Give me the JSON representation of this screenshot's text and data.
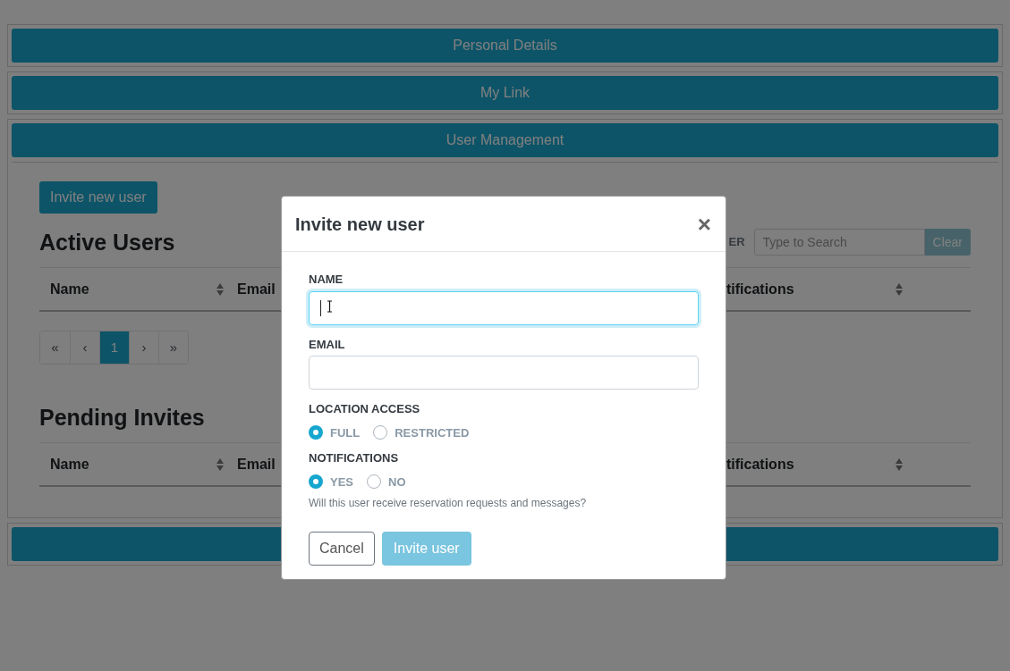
{
  "accordion": [
    {
      "title": "Personal Details",
      "expanded": false
    },
    {
      "title": "My Link",
      "expanded": false
    },
    {
      "title": "User Management",
      "expanded": true
    },
    {
      "expanded": false
    }
  ],
  "user_management": {
    "invite_button": "Invite new user",
    "active_users": {
      "heading": "Active Users",
      "filter_label": "ER",
      "search": {
        "placeholder": "Type to Search"
      },
      "clear_button": "Clear",
      "columns": [
        "Name",
        "Email",
        "tifications"
      ]
    },
    "pagination": [
      {
        "label": "«",
        "selected": false
      },
      {
        "label": "‹",
        "selected": false
      },
      {
        "label": "1",
        "selected": true
      },
      {
        "label": "›",
        "selected": false
      },
      {
        "label": "»",
        "selected": false
      }
    ],
    "pending_invites": {
      "heading": "Pending Invites",
      "columns": [
        "Name",
        "Email",
        "tifications"
      ]
    }
  },
  "modal": {
    "title": "Invite new user",
    "close": "×",
    "fields": [
      {
        "label": "NAME",
        "focused": true
      },
      {
        "label": "EMAIL",
        "focused": false
      }
    ],
    "radio_groups": [
      {
        "label": "LOCATION ACCESS",
        "options": [
          {
            "label": "FULL",
            "selected": true
          },
          {
            "label": "RESTRICTED",
            "selected": false
          }
        ]
      },
      {
        "label": "NOTIFICATIONS",
        "options": [
          {
            "label": "YES",
            "selected": true
          },
          {
            "label": "NO",
            "selected": false
          }
        ],
        "help": "Will this user receive reservation requests and messages?"
      }
    ],
    "cancel_button": "Cancel",
    "submit_button": {
      "label": "Invite user",
      "disabled": true
    }
  }
}
